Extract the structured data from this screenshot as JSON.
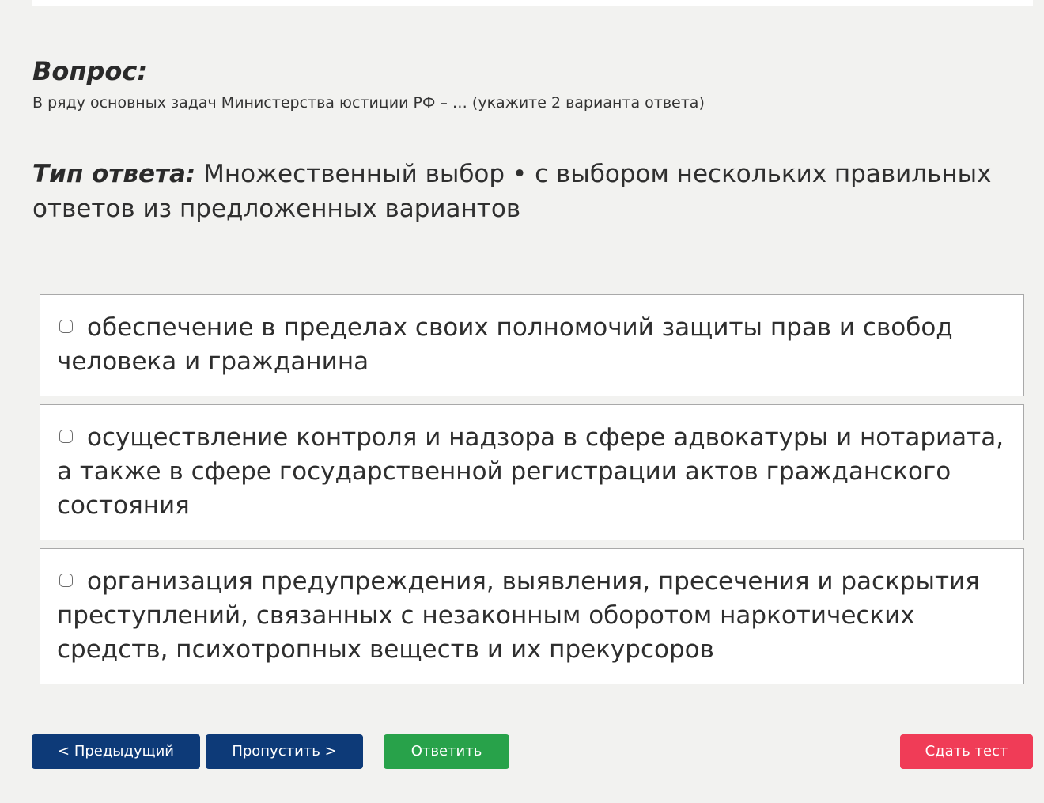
{
  "question": {
    "heading": "Вопрос:",
    "text": "В ряду основных задач Министерства юстиции РФ – … (укажите 2 варианта ответа)"
  },
  "answer_type": {
    "label": "Тип ответа:",
    "value": " Множественный выбор • с выбором нескольких правильных ответов из предложенных вариантов"
  },
  "options": [
    {
      "text": "обеспечение в пределах своих полномочий защиты прав и свобод человека и гражданина",
      "checked": false
    },
    {
      "text": "осуществление контроля и надзора в сфере адвокатуры и нотариата, а также в сфере государственной регистрации актов гражданского состояния",
      "checked": false
    },
    {
      "text": "организация предупреждения, выявления, пресечения и раскрытия преступлений, связанных с незаконным оборотом наркотических средств, психотропных веществ и их прекурсоров",
      "checked": false
    }
  ],
  "buttons": {
    "prev": "< Предыдущий",
    "skip": "Пропустить >",
    "answer": "Ответить",
    "finish": "Сдать тест"
  },
  "colors": {
    "background": "#f2f2f0",
    "nav_button": "#0d3a78",
    "answer_button": "#28a24a",
    "finish_button": "#f03c57"
  }
}
